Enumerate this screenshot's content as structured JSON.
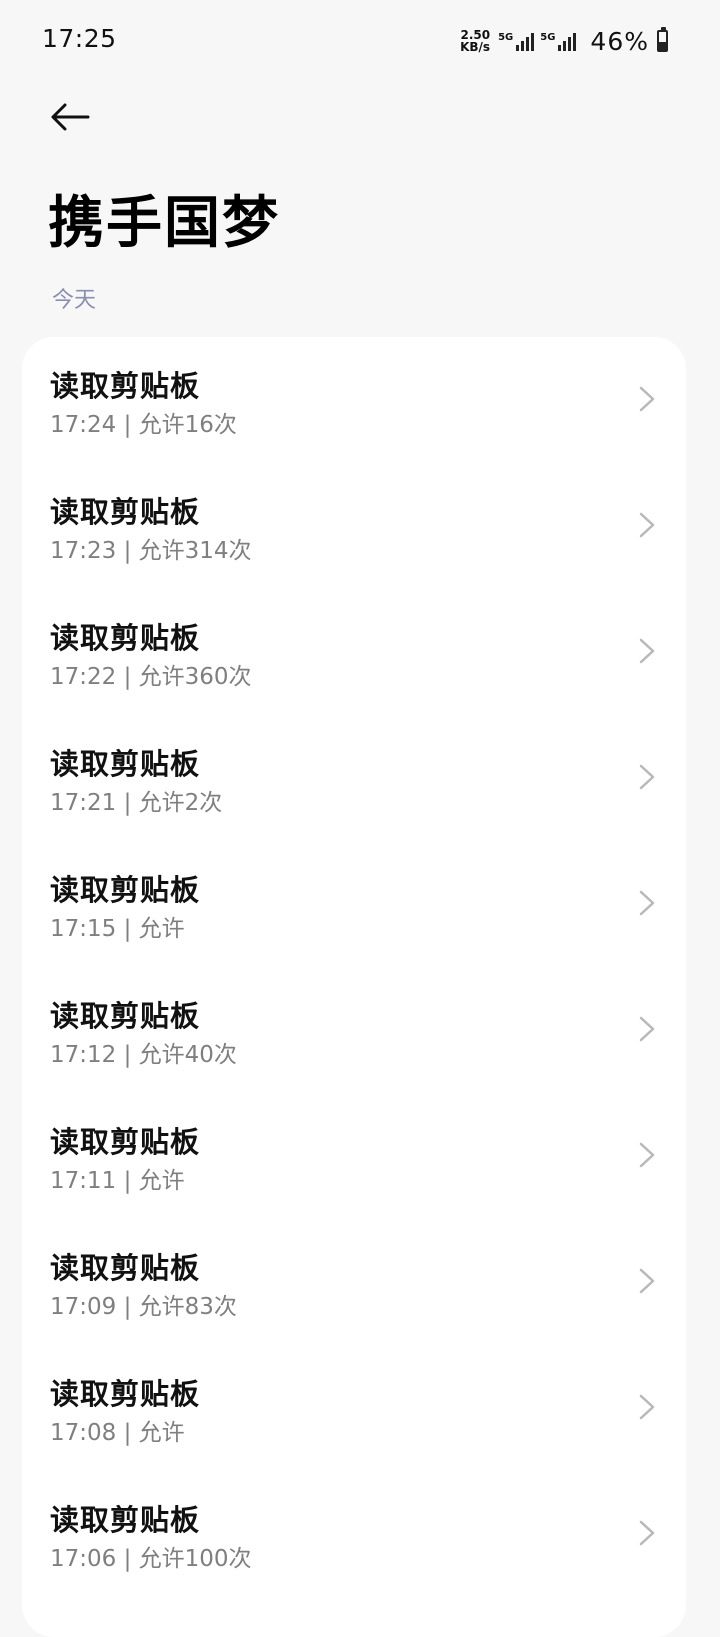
{
  "status_bar": {
    "time": "17:25",
    "net_speed_value": "2.50",
    "net_speed_unit": "KB/s",
    "sim1_label": "5G",
    "sim2_label": "5G",
    "battery_text": "46%",
    "battery_level": 0.46
  },
  "header": {
    "back_icon": "arrow-left-icon",
    "title": "携手国梦"
  },
  "section": {
    "label": "今天"
  },
  "items": [
    {
      "title": "读取剪贴板",
      "subtitle": "17:24 | 允许16次"
    },
    {
      "title": "读取剪贴板",
      "subtitle": "17:23 | 允许314次"
    },
    {
      "title": "读取剪贴板",
      "subtitle": "17:22 | 允许360次"
    },
    {
      "title": "读取剪贴板",
      "subtitle": "17:21 | 允许2次"
    },
    {
      "title": "读取剪贴板",
      "subtitle": "17:15 | 允许"
    },
    {
      "title": "读取剪贴板",
      "subtitle": "17:12 | 允许40次"
    },
    {
      "title": "读取剪贴板",
      "subtitle": "17:11 | 允许"
    },
    {
      "title": "读取剪贴板",
      "subtitle": "17:09 | 允许83次"
    },
    {
      "title": "读取剪贴板",
      "subtitle": "17:08 | 允许"
    },
    {
      "title": "读取剪贴板",
      "subtitle": "17:06 | 允许100次"
    }
  ],
  "colors": {
    "background": "#f7f7f7",
    "card": "#ffffff",
    "section_label": "#8a8fb0",
    "subtitle": "#7f7f7f",
    "chevron": "#b8b8b8"
  }
}
